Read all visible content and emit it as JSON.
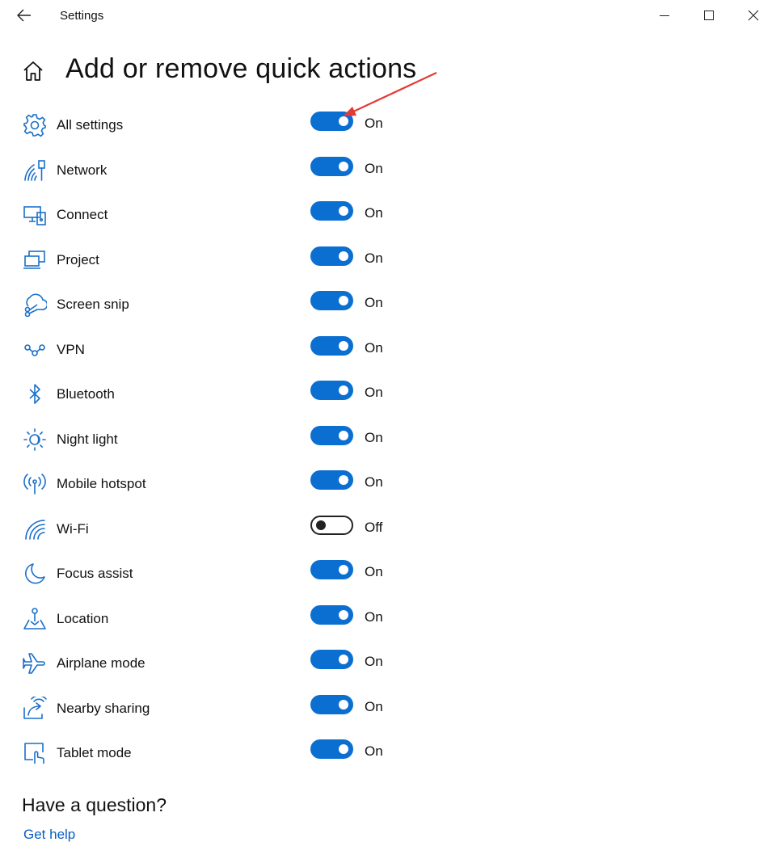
{
  "window": {
    "app_title": "Settings"
  },
  "page": {
    "title": "Add or remove quick actions"
  },
  "quick_actions": [
    {
      "label": "All settings",
      "icon": "gear-icon",
      "state": "On",
      "on": true
    },
    {
      "label": "Network",
      "icon": "network-icon",
      "state": "On",
      "on": true
    },
    {
      "label": "Connect",
      "icon": "connect-icon",
      "state": "On",
      "on": true
    },
    {
      "label": "Project",
      "icon": "project-icon",
      "state": "On",
      "on": true
    },
    {
      "label": "Screen snip",
      "icon": "screen-snip-icon",
      "state": "On",
      "on": true
    },
    {
      "label": "VPN",
      "icon": "vpn-icon",
      "state": "On",
      "on": true
    },
    {
      "label": "Bluetooth",
      "icon": "bluetooth-icon",
      "state": "On",
      "on": true
    },
    {
      "label": "Night light",
      "icon": "night-light-icon",
      "state": "On",
      "on": true
    },
    {
      "label": "Mobile hotspot",
      "icon": "hotspot-icon",
      "state": "On",
      "on": true
    },
    {
      "label": "Wi-Fi",
      "icon": "wifi-icon",
      "state": "Off",
      "on": false
    },
    {
      "label": "Focus assist",
      "icon": "moon-icon",
      "state": "On",
      "on": true
    },
    {
      "label": "Location",
      "icon": "location-icon",
      "state": "On",
      "on": true
    },
    {
      "label": "Airplane mode",
      "icon": "airplane-icon",
      "state": "On",
      "on": true
    },
    {
      "label": "Nearby sharing",
      "icon": "nearby-sharing-icon",
      "state": "On",
      "on": true
    },
    {
      "label": "Tablet mode",
      "icon": "tablet-mode-icon",
      "state": "On",
      "on": true
    }
  ],
  "help": {
    "title": "Have a question?",
    "link": "Get help"
  },
  "colors": {
    "accent": "#0a6fd1",
    "link": "#0a5fbf",
    "annotation_arrow": "#e53935"
  }
}
